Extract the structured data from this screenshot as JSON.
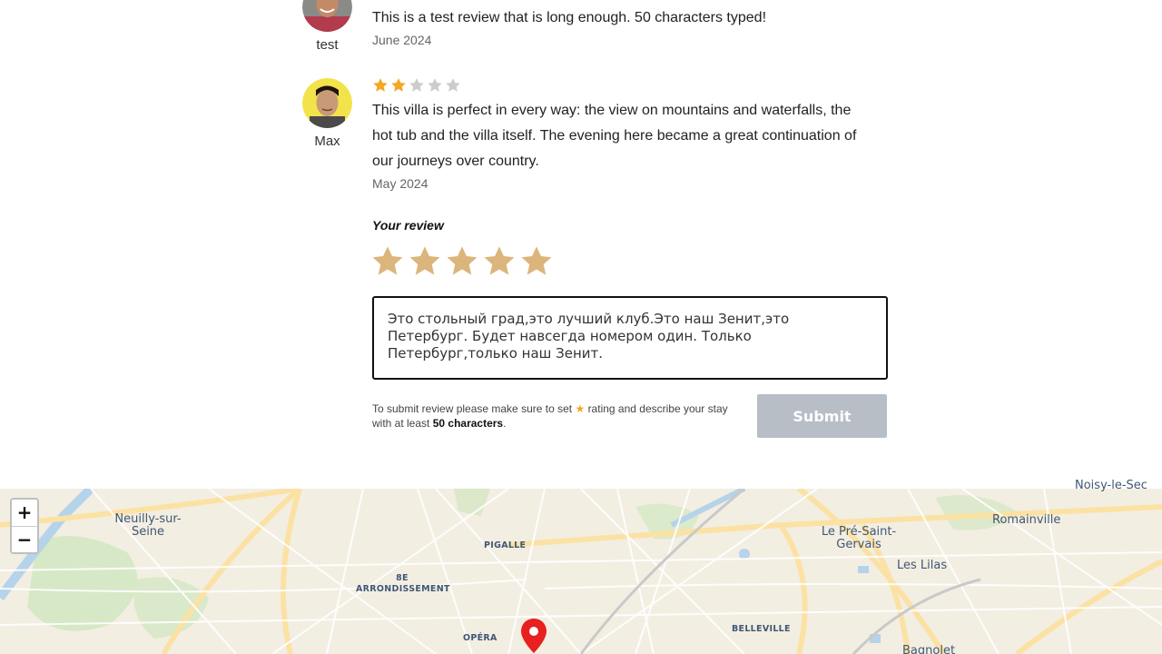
{
  "reviews": [
    {
      "author": "test",
      "rating": 0,
      "text": "This is a test review that is long enough. 50 characters typed!",
      "date": "June 2024"
    },
    {
      "author": "Max",
      "rating": 2,
      "text": "This villa is perfect in every way: the view on mountains and waterfalls, the hot tub and the villa itself. The evening here became a great continuation of our journeys over country.",
      "date": "May 2024"
    }
  ],
  "form": {
    "heading": "Your review",
    "star_count": 5,
    "textarea_value": "Это стольный град,это лучший клуб.Это наш Зенит,это Петербург. Будет навсегда номером один. Только Петербург,только наш Зенит.",
    "hint_prefix": "To submit review please make sure to set",
    "hint_star": "★",
    "hint_middle": "rating and describe your stay with at least",
    "hint_bold": "50 characters",
    "hint_suffix": ".",
    "submit_label": "Submit"
  },
  "map": {
    "zoom_in": "+",
    "zoom_out": "−",
    "places": [
      "Neuilly-sur-Seine",
      "PIGALLE",
      "8E ARRONDISSEMENT",
      "OPÉRA",
      "Le Pré-Saint-Gervais",
      "Les Lilas",
      "Romainville",
      "BELLEVILLE",
      "Bagnolet",
      "Noisy-le-Sec"
    ]
  },
  "colors": {
    "star_active": "#f5a623",
    "star_inactive": "#cccccc",
    "star_form": "#dcb57c",
    "submit_bg": "#b8bec6",
    "pin": "#e8201f"
  }
}
